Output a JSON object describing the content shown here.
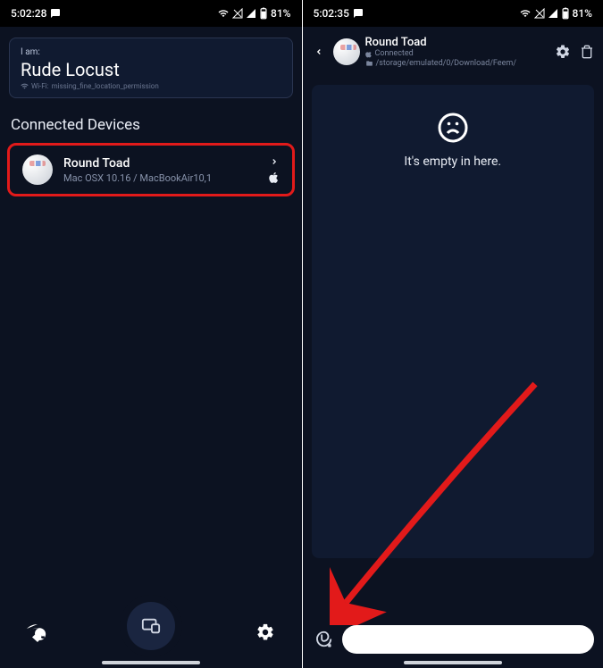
{
  "accent_red": "#e21a1a",
  "screen1": {
    "status": {
      "time": "5:02:28",
      "battery": "81%"
    },
    "identity": {
      "iam_label": "I am:",
      "name": "Rude Locust",
      "wifi_prefix": "Wi-Fi:",
      "wifi_value": "missing_fine_location_permission"
    },
    "section_title": "Connected Devices",
    "device": {
      "name": "Round Toad",
      "sub": "Mac OSX 10.16 / MacBookAir10,1"
    }
  },
  "screen2": {
    "status": {
      "time": "5:02:35",
      "battery": "81%"
    },
    "header": {
      "name": "Round Toad",
      "status": "Connected",
      "path": "/storage/emulated/0/Download/Feem/"
    },
    "empty_text": "It's empty in here.",
    "input_placeholder": ""
  }
}
